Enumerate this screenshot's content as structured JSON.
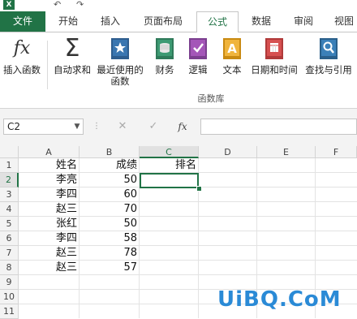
{
  "quick_access": {
    "excel_logo": "X",
    "undo": "↶",
    "redo": "↷"
  },
  "tabs": [
    {
      "label": "文件"
    },
    {
      "label": "开始"
    },
    {
      "label": "插入"
    },
    {
      "label": "页面布局"
    },
    {
      "label": "公式"
    },
    {
      "label": "数据"
    },
    {
      "label": "审阅"
    },
    {
      "label": "视图"
    }
  ],
  "ribbon": {
    "insert_function": {
      "label": "插入函数",
      "icon": "fx"
    },
    "autosum": {
      "label": "自动求和",
      "icon": "Σ"
    },
    "recent": {
      "label": "最近使用的",
      "label2": "函数"
    },
    "financial": {
      "label": "财务"
    },
    "logical": {
      "label": "逻辑"
    },
    "text": {
      "label": "文本"
    },
    "datetime": {
      "label": "日期和时间"
    },
    "lookup": {
      "label": "查找与引用"
    },
    "group_label": "函数库"
  },
  "formula_bar": {
    "name_box": "C2",
    "cancel": "✕",
    "enter": "✓",
    "fx": "fx",
    "value": ""
  },
  "columns": [
    "A",
    "B",
    "C",
    "D",
    "E",
    "F"
  ],
  "rows": [
    "1",
    "2",
    "3",
    "4",
    "5",
    "6",
    "7",
    "8",
    "9",
    "10",
    "11"
  ],
  "cells": {
    "A1": "姓名",
    "B1": "成绩",
    "C1": "排名",
    "A2": "李亮",
    "B2": "50",
    "A3": "李四",
    "B3": "60",
    "A4": "赵三",
    "B4": "70",
    "A5": "张红",
    "B5": "50",
    "A6": "李四",
    "B6": "58",
    "A7": "赵三",
    "B7": "78",
    "A8": "赵三",
    "B8": "57"
  },
  "watermark": "UiBQ.CoM",
  "colors": {
    "accent": "#217346",
    "watermark": "#2a8ad6"
  }
}
